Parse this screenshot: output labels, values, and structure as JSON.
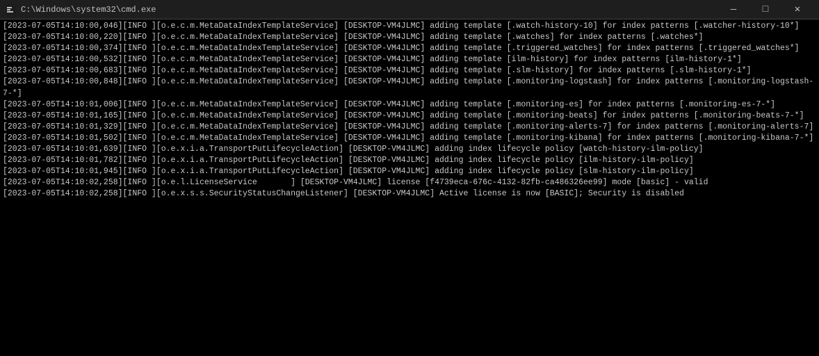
{
  "titlebar": {
    "icon": "■",
    "title": "C:\\Windows\\system32\\cmd.exe",
    "minimize_label": "—",
    "maximize_label": "□",
    "close_label": "✕"
  },
  "console": {
    "lines": [
      "[2023-07-05T14:10:00,046][INFO ][o.e.c.m.MetaDataIndexTemplateService] [DESKTOP-VM4JLMC] adding template [.watch-history-10] for index patterns [.watcher-history-10*]",
      "[2023-07-05T14:10:00,220][INFO ][o.e.c.m.MetaDataIndexTemplateService] [DESKTOP-VM4JLMC] adding template [.watches] for index patterns [.watches*]",
      "[2023-07-05T14:10:00,374][INFO ][o.e.c.m.MetaDataIndexTemplateService] [DESKTOP-VM4JLMC] adding template [.triggered_watches] for index patterns [.triggered_watches*]",
      "[2023-07-05T14:10:00,532][INFO ][o.e.c.m.MetaDataIndexTemplateService] [DESKTOP-VM4JLMC] adding template [ilm-history] for index patterns [ilm-history-1*]",
      "[2023-07-05T14:10:00,683][INFO ][o.e.c.m.MetaDataIndexTemplateService] [DESKTOP-VM4JLMC] adding template [.slm-history] for index patterns [.slm-history-1*]",
      "[2023-07-05T14:10:00,848][INFO ][o.e.c.m.MetaDataIndexTemplateService] [DESKTOP-VM4JLMC] adding template [.monitoring-logstash] for index patterns [.monitoring-logstash-7-*]",
      "[2023-07-05T14:10:01,006][INFO ][o.e.c.m.MetaDataIndexTemplateService] [DESKTOP-VM4JLMC] adding template [.monitoring-es] for index patterns [.monitoring-es-7-*]",
      "[2023-07-05T14:10:01,165][INFO ][o.e.c.m.MetaDataIndexTemplateService] [DESKTOP-VM4JLMC] adding template [.monitoring-beats] for index patterns [.monitoring-beats-7-*]",
      "[2023-07-05T14:10:01,329][INFO ][o.e.c.m.MetaDataIndexTemplateService] [DESKTOP-VM4JLMC] adding template [.monitoring-alerts-7] for index patterns [.monitoring-alerts-7]",
      "[2023-07-05T14:10:01,502][INFO ][o.e.c.m.MetaDataIndexTemplateService] [DESKTOP-VM4JLMC] adding template [.monitoring-kibana] for index patterns [.monitoring-kibana-7-*]",
      "[2023-07-05T14:10:01,639][INFO ][o.e.x.i.a.TransportPutLifecycleAction] [DESKTOP-VM4JLMC] adding index lifecycle policy [watch-history-ilm-policy]",
      "[2023-07-05T14:10:01,782][INFO ][o.e.x.i.a.TransportPutLifecycleAction] [DESKTOP-VM4JLMC] adding index lifecycle policy [ilm-history-ilm-policy]",
      "[2023-07-05T14:10:01,945][INFO ][o.e.x.i.a.TransportPutLifecycleAction] [DESKTOP-VM4JLMC] adding index lifecycle policy [slm-history-ilm-policy]",
      "[2023-07-05T14:10:02,258][INFO ][o.e.l.LicenseService       ] [DESKTOP-VM4JLMC] license [f4739eca-676c-4132-82fb-ca486326ee99] mode [basic] - valid",
      "[2023-07-05T14:10:02,258][INFO ][o.e.x.s.s.SecurityStatusChangeListener] [DESKTOP-VM4JLMC] Active license is now [BASIC]; Security is disabled"
    ]
  }
}
